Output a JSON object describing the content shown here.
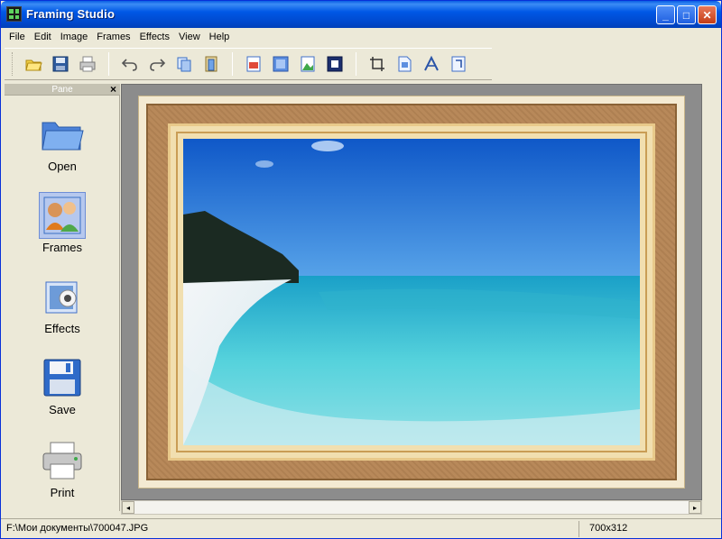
{
  "window": {
    "title": "Framing Studio",
    "controls": {
      "minimize": "_",
      "maximize": "□",
      "close": "✕"
    }
  },
  "menu": [
    "File",
    "Edit",
    "Image",
    "Frames",
    "Effects",
    "View",
    "Help"
  ],
  "toolbar": {
    "groups": [
      [
        "open-icon",
        "save-icon",
        "print-icon"
      ],
      [
        "undo-icon",
        "redo-icon",
        "copy-icon",
        "paste-icon"
      ],
      [
        "image-red-icon",
        "frame-blue-icon",
        "landscape-icon",
        "border-icon"
      ],
      [
        "crop-icon",
        "page-icon",
        "text-icon",
        "resize-icon"
      ]
    ]
  },
  "panel": {
    "title": "Pane",
    "close": "×",
    "items": [
      {
        "label": "Open",
        "icon": "folder-icon"
      },
      {
        "label": "Frames",
        "icon": "frames-icon",
        "selected": true
      },
      {
        "label": "Effects",
        "icon": "effects-icon"
      },
      {
        "label": "Save",
        "icon": "floppy-icon"
      },
      {
        "label": "Print",
        "icon": "printer-icon"
      }
    ]
  },
  "canvas": {
    "photo_alt": "beach-photo"
  },
  "scrollbar": {
    "left": "◂",
    "right": "▸"
  },
  "status": {
    "path": "F:\\Мои документы\\700047.JPG",
    "size": "700x312"
  },
  "colors": {
    "titlebar": "#0058e6",
    "sky": "#1f6fd6",
    "water": "#48c8d8",
    "sand": "#eef3f6",
    "frame_wood": "#b8895a"
  }
}
